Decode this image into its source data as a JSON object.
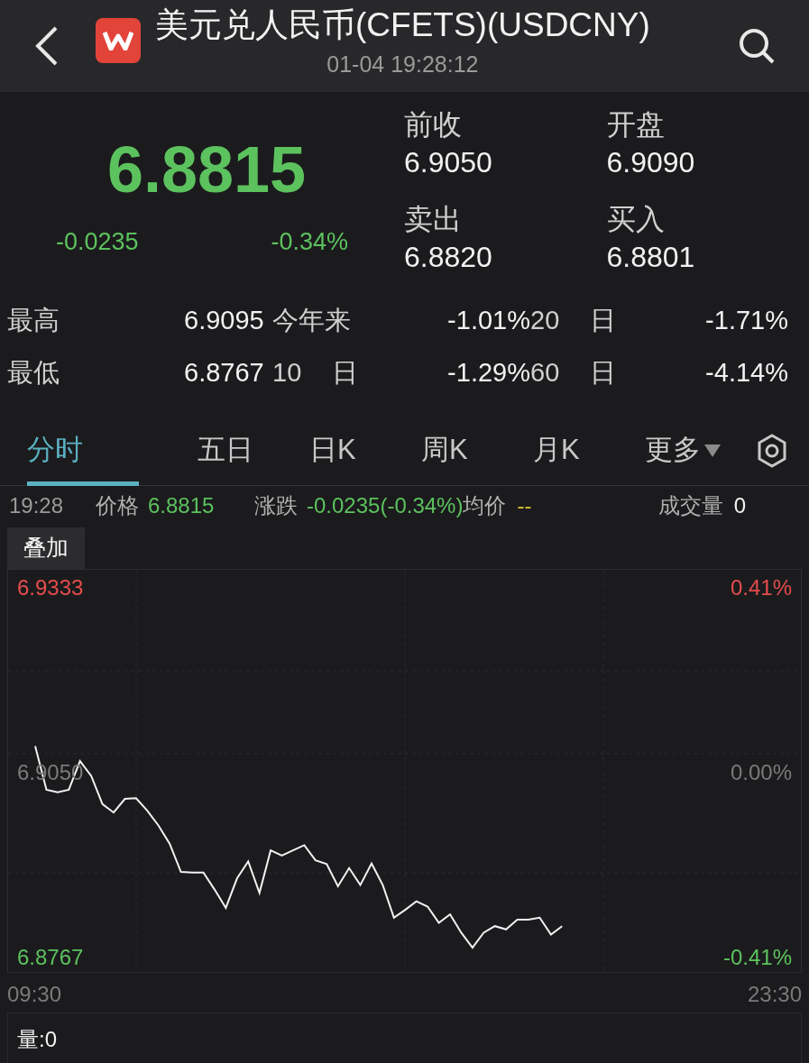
{
  "header": {
    "title": "美元兑人民币(CFETS)(USDCNY)",
    "time": "01-04 19:28:12"
  },
  "quote": {
    "price": "6.8815",
    "change": "-0.0235",
    "change_pct": "-0.34%"
  },
  "fields": [
    {
      "label": "前收",
      "value": "6.9050"
    },
    {
      "label": "开盘",
      "value": "6.9090"
    },
    {
      "label": "卖出",
      "value": "6.8820"
    },
    {
      "label": "买入",
      "value": "6.8801"
    }
  ],
  "stats": [
    {
      "label": "最高",
      "value": "6.9095",
      "cells": [
        {
          "period": "今年来",
          "change": "-1.01%"
        },
        {
          "period": "20",
          "unit": "日",
          "change": "-1.71%"
        }
      ]
    },
    {
      "label": "最低",
      "value": "6.8767",
      "cells": [
        {
          "period": "10",
          "unit": "日",
          "change": "-1.29%"
        },
        {
          "period": "60",
          "unit": "日",
          "change": "-4.14%"
        }
      ]
    }
  ],
  "tabs": [
    {
      "label": "分时",
      "selected": true
    },
    {
      "label": "五日",
      "selected": false
    },
    {
      "label": "日K",
      "selected": false
    },
    {
      "label": "周K",
      "selected": false
    },
    {
      "label": "月K",
      "selected": false
    },
    {
      "label": "更多",
      "selected": false,
      "dropdown": true
    }
  ],
  "info": {
    "time": "19:28",
    "price_label": "价格",
    "price": "6.8815",
    "change_label": "涨跌",
    "change": "-0.0235(-0.34%)",
    "avg_label": "均价",
    "avg": "--",
    "volume_label": "成交量",
    "volume": "0"
  },
  "overlay_button": "叠加",
  "chart": {
    "right_labels": [
      "0.41%",
      "0.00%",
      "-0.41%"
    ],
    "volume": "量:0",
    "chart_data": {
      "type": "line",
      "xlim": [
        8.988,
        24.012
      ],
      "ylim": [
        6.8742,
        6.9361
      ],
      "xticks": [
        {
          "value": 9.5,
          "label": "09:30"
        },
        {
          "value": 23.5,
          "label": "23:30"
        }
      ],
      "yticks": [
        {
          "value": 6.9333,
          "label": "6.9333"
        },
        {
          "value": 6.905,
          "label": "6.9050"
        },
        {
          "value": 6.8767,
          "label": "6.8767"
        }
      ],
      "x": [
        9.5,
        9.712,
        9.924,
        10.136,
        10.348,
        10.56,
        10.772,
        10.984,
        11.196,
        11.408,
        11.62,
        11.832,
        12.044,
        12.256,
        12.468,
        12.68,
        12.892,
        13.104,
        13.316,
        13.528,
        13.74,
        13.952,
        14.164,
        14.376,
        14.588,
        14.8,
        15.012,
        15.224,
        15.436,
        15.648,
        15.86,
        16.072,
        16.284,
        16.496,
        16.708,
        16.92,
        17.132,
        17.344,
        17.556,
        17.768,
        17.98,
        18.192,
        18.404,
        18.616,
        18.828,
        19.04,
        19.252,
        19.464
      ],
      "series": [
        {
          "color": "#f2f2f2",
          "values": [
            6.9091,
            6.9024,
            6.902,
            6.9024,
            6.9068,
            6.9045,
            6.9002,
            6.8989,
            6.901,
            6.9011,
            6.8992,
            6.8969,
            6.8941,
            6.8898,
            6.8897,
            6.8897,
            6.8871,
            6.8843,
            6.8888,
            6.8914,
            6.8866,
            6.8931,
            6.8923,
            6.8931,
            6.8939,
            6.8916,
            6.891,
            6.8876,
            6.8904,
            6.8878,
            6.8911,
            6.8878,
            6.8828,
            6.884,
            6.8853,
            6.8845,
            6.882,
            6.8833,
            6.8805,
            6.8782,
            6.8805,
            6.8815,
            6.881,
            6.8825,
            6.8825,
            6.8828,
            6.8802,
            6.8815
          ]
        }
      ]
    }
  }
}
